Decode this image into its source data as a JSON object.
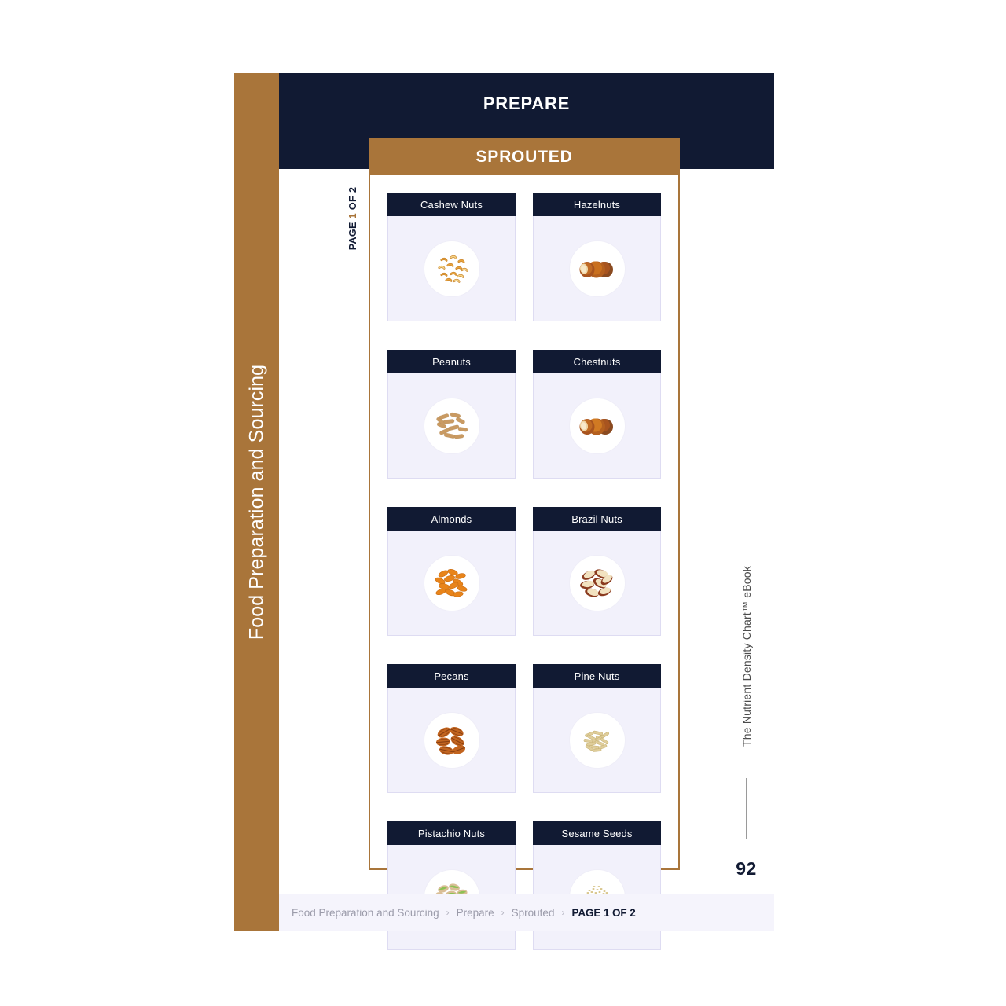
{
  "sidebar": {
    "label": "Food Preparation and Sourcing",
    "bg_color": "#A9753A"
  },
  "header": {
    "section_title": "PREPARE",
    "bg_color": "#111A33"
  },
  "page_marker": {
    "prefix": "PAGE ",
    "number": "1",
    "suffix": " OF 2"
  },
  "panel": {
    "title": "SPROUTED",
    "accent_color": "#A9753A",
    "cards": [
      {
        "label": "Cashew Nuts",
        "icon": "cashew-nuts-illustration"
      },
      {
        "label": "Hazelnuts",
        "icon": "hazelnuts-illustration"
      },
      {
        "label": "Peanuts",
        "icon": "peanuts-illustration"
      },
      {
        "label": "Chestnuts",
        "icon": "chestnuts-illustration"
      },
      {
        "label": "Almonds",
        "icon": "almonds-illustration"
      },
      {
        "label": "Brazil Nuts",
        "icon": "brazil-nuts-illustration"
      },
      {
        "label": "Pecans",
        "icon": "pecans-illustration"
      },
      {
        "label": "Pine Nuts",
        "icon": "pine-nuts-illustration"
      },
      {
        "label": "Pistachio Nuts",
        "icon": "pistachio-nuts-illustration"
      },
      {
        "label": "Sesame Seeds",
        "icon": "sesame-seeds-illustration"
      }
    ]
  },
  "ebook": {
    "title": "The Nutrient Density Chart™  eBook",
    "page_number": "92"
  },
  "footer": {
    "crumbs": [
      "Food Preparation and Sourcing",
      "Prepare",
      "Sprouted"
    ],
    "separator": "›",
    "current": "PAGE 1 OF 2"
  }
}
